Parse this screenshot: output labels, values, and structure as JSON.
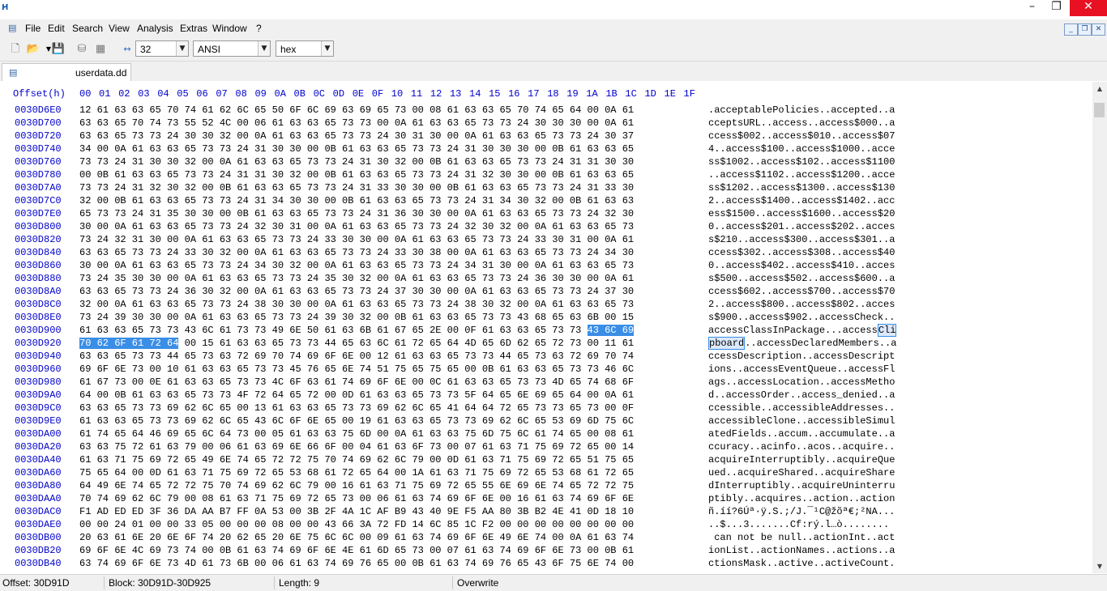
{
  "window": {
    "icon": "hxd-app-icon",
    "controls": {
      "minimize": "–",
      "maximize": "❐",
      "close": "✕"
    }
  },
  "menu": {
    "items": [
      "File",
      "Edit",
      "Search",
      "View",
      "Analysis",
      "Extras",
      "Window",
      "?"
    ]
  },
  "toolbar": {
    "bytes_per_row": "32",
    "charset": "ANSI",
    "display_mode": "hex"
  },
  "tabs": [
    {
      "label": "userdata.dd"
    }
  ],
  "editor": {
    "offset_header": "Offset(h)",
    "columns": [
      "00",
      "01",
      "02",
      "03",
      "04",
      "05",
      "06",
      "07",
      "08",
      "09",
      "0A",
      "0B",
      "0C",
      "0D",
      "0E",
      "0F",
      "10",
      "11",
      "12",
      "13",
      "14",
      "15",
      "16",
      "17",
      "18",
      "19",
      "1A",
      "1B",
      "1C",
      "1D",
      "1E",
      "1F"
    ],
    "rows": [
      {
        "offset": "0030D6E0",
        "hex": "12 61 63 63 65 70 74 61 62 6C 65 50 6F 6C 69 63 69 65 73 00 08 61 63 63 65 70 74 65 64 00 0A 61",
        "ascii": ".acceptablePolicies..accepted..a"
      },
      {
        "offset": "0030D700",
        "hex": "63 63 65 70 74 73 55 52 4C 00 06 61 63 63 65 73 73 00 0A 61 63 63 65 73 73 24 30 30 30 00 0A 61",
        "ascii": "cceptsURL..access..access$000..a"
      },
      {
        "offset": "0030D720",
        "hex": "63 63 65 73 73 24 30 30 32 00 0A 61 63 63 65 73 73 24 30 31 30 00 0A 61 63 63 65 73 73 24 30 37",
        "ascii": "ccess$002..access$010..access$07"
      },
      {
        "offset": "0030D740",
        "hex": "34 00 0A 61 63 63 65 73 73 24 31 30 30 00 0B 61 63 63 65 73 73 24 31 30 30 30 00 0B 61 63 63 65",
        "ascii": "4..access$100..access$1000..acce"
      },
      {
        "offset": "0030D760",
        "hex": "73 73 24 31 30 30 32 00 0A 61 63 63 65 73 73 24 31 30 32 00 0B 61 63 63 65 73 73 24 31 31 30 30",
        "ascii": "ss$1002..access$102..access$1100"
      },
      {
        "offset": "0030D780",
        "hex": "00 0B 61 63 63 65 73 73 24 31 31 30 32 00 0B 61 63 63 65 73 73 24 31 32 30 30 00 0B 61 63 63 65",
        "ascii": "..access$1102..access$1200..acce"
      },
      {
        "offset": "0030D7A0",
        "hex": "73 73 24 31 32 30 32 00 0B 61 63 63 65 73 73 24 31 33 30 30 00 0B 61 63 63 65 73 73 24 31 33 30",
        "ascii": "ss$1202..access$1300..access$130"
      },
      {
        "offset": "0030D7C0",
        "hex": "32 00 0B 61 63 63 65 73 73 24 31 34 30 30 00 0B 61 63 63 65 73 73 24 31 34 30 32 00 0B 61 63 63",
        "ascii": "2..access$1400..access$1402..acc"
      },
      {
        "offset": "0030D7E0",
        "hex": "65 73 73 24 31 35 30 30 00 0B 61 63 63 65 73 73 24 31 36 30 30 00 0A 61 63 63 65 73 73 24 32 30",
        "ascii": "ess$1500..access$1600..access$20"
      },
      {
        "offset": "0030D800",
        "hex": "30 00 0A 61 63 63 65 73 73 24 32 30 31 00 0A 61 63 63 65 73 73 24 32 30 32 00 0A 61 63 63 65 73",
        "ascii": "0..access$201..access$202..acces"
      },
      {
        "offset": "0030D820",
        "hex": "73 24 32 31 30 00 0A 61 63 63 65 73 73 24 33 30 30 00 0A 61 63 63 65 73 73 24 33 30 31 00 0A 61",
        "ascii": "s$210..access$300..access$301..a"
      },
      {
        "offset": "0030D840",
        "hex": "63 63 65 73 73 24 33 30 32 00 0A 61 63 63 65 73 73 24 33 30 38 00 0A 61 63 63 65 73 73 24 34 30",
        "ascii": "ccess$302..access$308..access$40"
      },
      {
        "offset": "0030D860",
        "hex": "30 00 0A 61 63 63 65 73 73 24 34 30 32 00 0A 61 63 63 65 73 73 24 34 31 30 00 0A 61 63 63 65 73",
        "ascii": "0..access$402..access$410..acces"
      },
      {
        "offset": "0030D880",
        "hex": "73 24 35 30 30 00 0A 61 63 63 65 73 73 24 35 30 32 00 0A 61 63 63 65 73 73 24 36 30 30 00 0A 61",
        "ascii": "s$500..access$502..access$600..a"
      },
      {
        "offset": "0030D8A0",
        "hex": "63 63 65 73 73 24 36 30 32 00 0A 61 63 63 65 73 73 24 37 30 30 00 0A 61 63 63 65 73 73 24 37 30",
        "ascii": "ccess$602..access$700..access$70"
      },
      {
        "offset": "0030D8C0",
        "hex": "32 00 0A 61 63 63 65 73 73 24 38 30 30 00 0A 61 63 63 65 73 73 24 38 30 32 00 0A 61 63 63 65 73",
        "ascii": "2..access$800..access$802..acces"
      },
      {
        "offset": "0030D8E0",
        "hex": "73 24 39 30 30 00 0A 61 63 63 65 73 73 24 39 30 32 00 0B 61 63 63 65 73 73 43 68 65 63 6B 00 15",
        "ascii": "s$900..access$902..accessCheck.."
      },
      {
        "offset": "0030D900",
        "hex": "61 63 63 65 73 73 43 6C 61 73 73 49 6E 50 61 63 6B 61 67 65 2E 00 0F 61 63 63 65 73 73",
        "hex_sel": "43 6C 69",
        "ascii": "accessClassInPackage...access",
        "ascii_sel": "Cli"
      },
      {
        "offset": "0030D920",
        "hex_sel_pre": "70 62 6F 61 72 64",
        "hex": " 00 15 61 63 63 65 73 73 44 65 63 6C 61 72 65 64 4D 65 6D 62 65 72 73 00 11 61",
        "ascii_sel_pre": "pboard",
        "ascii": "..accessDeclaredMembers..a"
      },
      {
        "offset": "0030D940",
        "hex": "63 63 65 73 73 44 65 73 63 72 69 70 74 69 6F 6E 00 12 61 63 63 65 73 73 44 65 73 63 72 69 70 74",
        "ascii": "ccessDescription..accessDescript"
      },
      {
        "offset": "0030D960",
        "hex": "69 6F 6E 73 00 10 61 63 63 65 73 73 45 76 65 6E 74 51 75 65 75 65 00 0B 61 63 63 65 73 73 46 6C",
        "ascii": "ions..accessEventQueue..accessFl"
      },
      {
        "offset": "0030D980",
        "hex": "61 67 73 00 0E 61 63 63 65 73 73 4C 6F 63 61 74 69 6F 6E 00 0C 61 63 63 65 73 73 4D 65 74 68 6F",
        "ascii": "ags..accessLocation..accessMetho"
      },
      {
        "offset": "0030D9A0",
        "hex": "64 00 0B 61 63 63 65 73 73 4F 72 64 65 72 00 0D 61 63 63 65 73 73 5F 64 65 6E 69 65 64 00 0A 61",
        "ascii": "d..accessOrder..access_denied..a"
      },
      {
        "offset": "0030D9C0",
        "hex": "63 63 65 73 73 69 62 6C 65 00 13 61 63 63 65 73 73 69 62 6C 65 41 64 64 72 65 73 73 65 73 00 0F",
        "ascii": "ccessible..accessibleAddresses.."
      },
      {
        "offset": "0030D9E0",
        "hex": "61 63 63 65 73 73 69 62 6C 65 43 6C 6F 6E 65 00 19 61 63 63 65 73 73 69 62 6C 65 53 69 6D 75 6C",
        "ascii": "accessibleClone..accessibleSimul"
      },
      {
        "offset": "0030DA00",
        "hex": "61 74 65 64 46 69 65 6C 64 73 00 05 61 63 63 75 6D 00 0A 61 63 63 75 6D 75 6C 61 74 65 00 08 61",
        "ascii": "atedFields..accum..accumulate..a"
      },
      {
        "offset": "0030DA20",
        "hex": "63 63 75 72 61 63 79 00 06 61 63 69 6E 66 6F 00 04 61 63 6F 73 00 07 61 63 71 75 69 72 65 00 14",
        "ascii": "ccuracy..acinfo..acos..acquire.."
      },
      {
        "offset": "0030DA40",
        "hex": "61 63 71 75 69 72 65 49 6E 74 65 72 72 75 70 74 69 62 6C 79 00 0D 61 63 71 75 69 72 65 51 75 65",
        "ascii": "acquireInterruptibly..acquireQue"
      },
      {
        "offset": "0030DA60",
        "hex": "75 65 64 00 0D 61 63 71 75 69 72 65 53 68 61 72 65 64 00 1A 61 63 71 75 69 72 65 53 68 61 72 65",
        "ascii": "ued..acquireShared..acquireShare"
      },
      {
        "offset": "0030DA80",
        "hex": "64 49 6E 74 65 72 72 75 70 74 69 62 6C 79 00 16 61 63 71 75 69 72 65 55 6E 69 6E 74 65 72 72 75",
        "ascii": "dInterruptibly..acquireUninterru"
      },
      {
        "offset": "0030DAA0",
        "hex": "70 74 69 62 6C 79 00 08 61 63 71 75 69 72 65 73 00 06 61 63 74 69 6F 6E 00 16 61 63 74 69 6F 6E",
        "ascii": "ptibly..acquires..action..action"
      },
      {
        "offset": "0030DAC0",
        "hex": "F1 AD ED ED 3F 36 DA AA B7 FF 0A 53 00 3B 2F 4A 1C AF B9 43 40 9E F5 AA 80 3B B2 4E 41 0D 18 10",
        "ascii": "ñ.íí?6Úª·ÿ.S.;/J.¯¹C@žõª€;²NA..."
      },
      {
        "offset": "0030DAE0",
        "hex": "00 00 24 01 00 00 33 05 00 00 00 08 00 00 43 66 3A 72 FD 14 6C 85 1C F2 00 00 00 00 00 00 00 00",
        "ascii": "..$...3.......Cf:rý.l…ò........"
      },
      {
        "offset": "0030DB00",
        "hex": "20 63 61 6E 20 6E 6F 74 20 62 65 20 6E 75 6C 6C 00 09 61 63 74 69 6F 6E 49 6E 74 00 0A 61 63 74",
        "ascii": " can not be null..actionInt..act"
      },
      {
        "offset": "0030DB20",
        "hex": "69 6F 6E 4C 69 73 74 00 0B 61 63 74 69 6F 6E 4E 61 6D 65 73 00 07 61 63 74 69 6F 6E 73 00 0B 61",
        "ascii": "ionList..actionNames..actions..a"
      },
      {
        "offset": "0030DB40",
        "hex": "63 74 69 6F 6E 73 4D 61 73 6B 00 06 61 63 74 69 76 65 00 0B 61 63 74 69 76 65 43 6F 75 6E 74 00",
        "ascii": "ctionsMask..active..activeCount."
      }
    ]
  },
  "status": {
    "offset": "Offset: 30D91D",
    "block": "Block: 30D91D-30D925",
    "length": "Length: 9",
    "mode": "Overwrite"
  }
}
